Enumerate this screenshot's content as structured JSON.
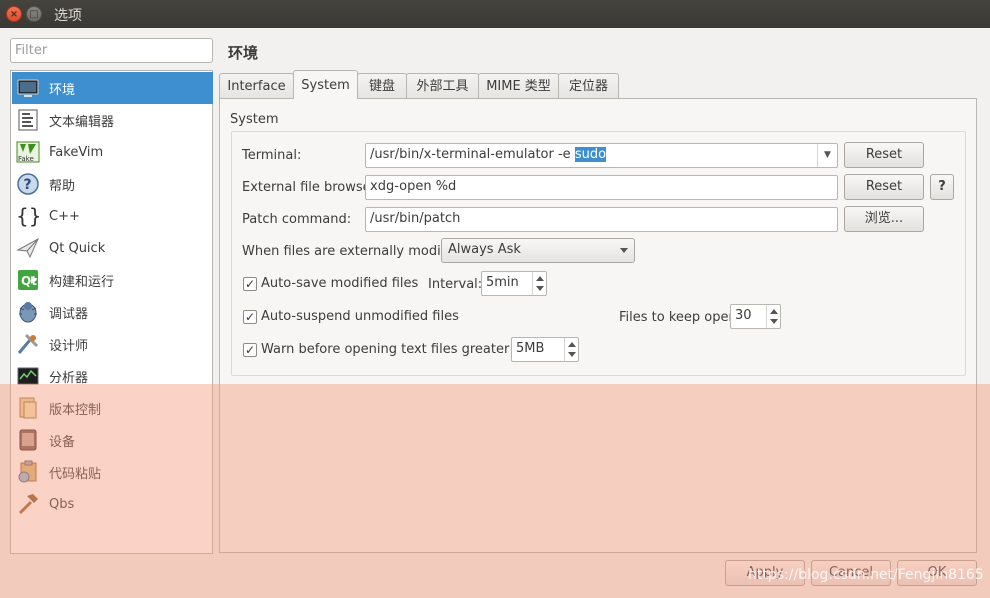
{
  "window": {
    "title": "选项",
    "close_glyph": "×",
    "max_glyph": "□"
  },
  "filter": {
    "placeholder": "Filter"
  },
  "categories": [
    {
      "label": "环境",
      "icon": "monitor-icon",
      "selected": true
    },
    {
      "label": "文本编辑器",
      "icon": "text-editor-icon"
    },
    {
      "label": "FakeVim",
      "icon": "fakevim-icon"
    },
    {
      "label": "帮助",
      "icon": "help-icon"
    },
    {
      "label": "C++",
      "icon": "cpp-braces-icon"
    },
    {
      "label": "Qt Quick",
      "icon": "qt-quick-icon"
    },
    {
      "label": "构建和运行",
      "icon": "build-run-icon"
    },
    {
      "label": "调试器",
      "icon": "debugger-icon"
    },
    {
      "label": "设计师",
      "icon": "designer-icon"
    },
    {
      "label": "分析器",
      "icon": "analyzer-icon"
    },
    {
      "label": "版本控制",
      "icon": "version-control-icon"
    },
    {
      "label": "设备",
      "icon": "device-icon"
    },
    {
      "label": "代码粘贴",
      "icon": "code-paste-icon"
    },
    {
      "label": "Qbs",
      "icon": "hammer-icon"
    }
  ],
  "page": {
    "title": "环境"
  },
  "tabs": [
    {
      "label": "Interface"
    },
    {
      "label": "System",
      "active": true
    },
    {
      "label": "键盘"
    },
    {
      "label": "外部工具"
    },
    {
      "label": "MIME 类型"
    },
    {
      "label": "定位器"
    }
  ],
  "system": {
    "group_title": "System",
    "terminal_label": "Terminal:",
    "terminal_value_plain": "/usr/bin/x-terminal-emulator -e ",
    "terminal_value_selected": "sudo",
    "terminal_reset": "Reset",
    "browser_label": "External file browser:",
    "browser_value": "xdg-open %d",
    "browser_reset": "Reset",
    "browser_help": "?",
    "patch_label": "Patch command:",
    "patch_value": "/usr/bin/patch",
    "patch_browse": "浏览...",
    "modified_label": "When files are externally modified:",
    "modified_value": "Always Ask",
    "autosave_label": "Auto-save modified files",
    "autosave_checked": true,
    "interval_label": "Interval:",
    "interval_value": "5min",
    "autosuspend_label": "Auto-suspend unmodified files",
    "autosuspend_checked": true,
    "keep_open_label": "Files to keep open:",
    "keep_open_value": "30",
    "warn_label": "Warn before opening text files greater than",
    "warn_checked": true,
    "warn_value": "5MB",
    "check_glyph": "✓"
  },
  "footer": {
    "apply": "Apply",
    "cancel": "Cancel",
    "ok": "OK"
  },
  "watermark": "https://blog.csdn.net/Fengjin8165",
  "colors": {
    "selection": "#3d8fd0",
    "overlay": "#f59678",
    "titlebar": "#3a3935"
  }
}
